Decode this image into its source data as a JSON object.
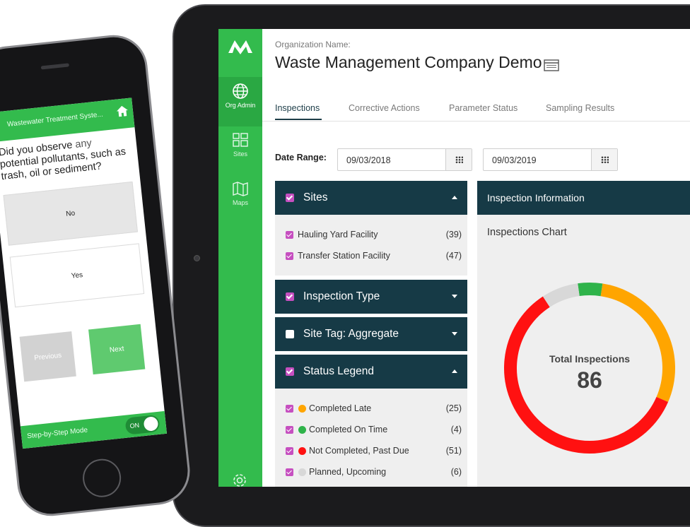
{
  "tablet": {
    "sidebar": {
      "items": [
        {
          "label": "Org Admin",
          "icon": "globe-icon"
        },
        {
          "label": "Sites",
          "icon": "grid-icon"
        },
        {
          "label": "Maps",
          "icon": "map-icon"
        }
      ]
    },
    "org": {
      "label": "Organization Name:",
      "name": "Waste Management Company Demo"
    },
    "tabs": [
      "Inspections",
      "Corrective Actions",
      "Parameter Status",
      "Sampling Results"
    ],
    "date_range": {
      "label": "Date Range:",
      "from": "09/03/2018",
      "to": "09/03/2019"
    },
    "panels": {
      "sites": {
        "title": "Sites",
        "items": [
          {
            "label": "Hauling Yard Facility",
            "count": "(39)"
          },
          {
            "label": "Transfer Station Facility",
            "count": "(47)"
          }
        ]
      },
      "inspection_type": {
        "title": "Inspection Type"
      },
      "site_tag": {
        "title": "Site Tag: Aggregate"
      },
      "status_legend": {
        "title": "Status Legend",
        "items": [
          {
            "label": "Completed Late",
            "count": "(25)",
            "color": "#ffa500"
          },
          {
            "label": "Completed On Time",
            "count": "(4)",
            "color": "#2fb34a"
          },
          {
            "label": "Not Completed, Past Due",
            "count": "(51)",
            "color": "#ff1111"
          },
          {
            "label": "Planned, Upcoming",
            "count": "(6)",
            "color": "#d8d8d8"
          }
        ]
      }
    },
    "info": {
      "title": "Inspection Information",
      "chart_title": "Inspections Chart"
    }
  },
  "chart_data": {
    "type": "pie",
    "categories": [
      "Completed Late",
      "Completed On Time",
      "Not Completed, Past Due",
      "Planned, Upcoming"
    ],
    "values": [
      25,
      4,
      51,
      6
    ],
    "colors": [
      "#ffa500",
      "#2fb34a",
      "#ff1111",
      "#d8d8d8"
    ],
    "center_label": "Total Inspections",
    "center_value": "86"
  },
  "phone": {
    "title": "Wastewater Treatment Syste...",
    "question_1": "Did you observe ",
    "question_hl": "any",
    "question_2": " potential pollutants, such as trash, oil or sediment?",
    "options": [
      "No",
      "Yes"
    ],
    "previous": "Previous",
    "next": "Next",
    "mode_label": "Step-by-Step Mode",
    "toggle": "ON"
  }
}
